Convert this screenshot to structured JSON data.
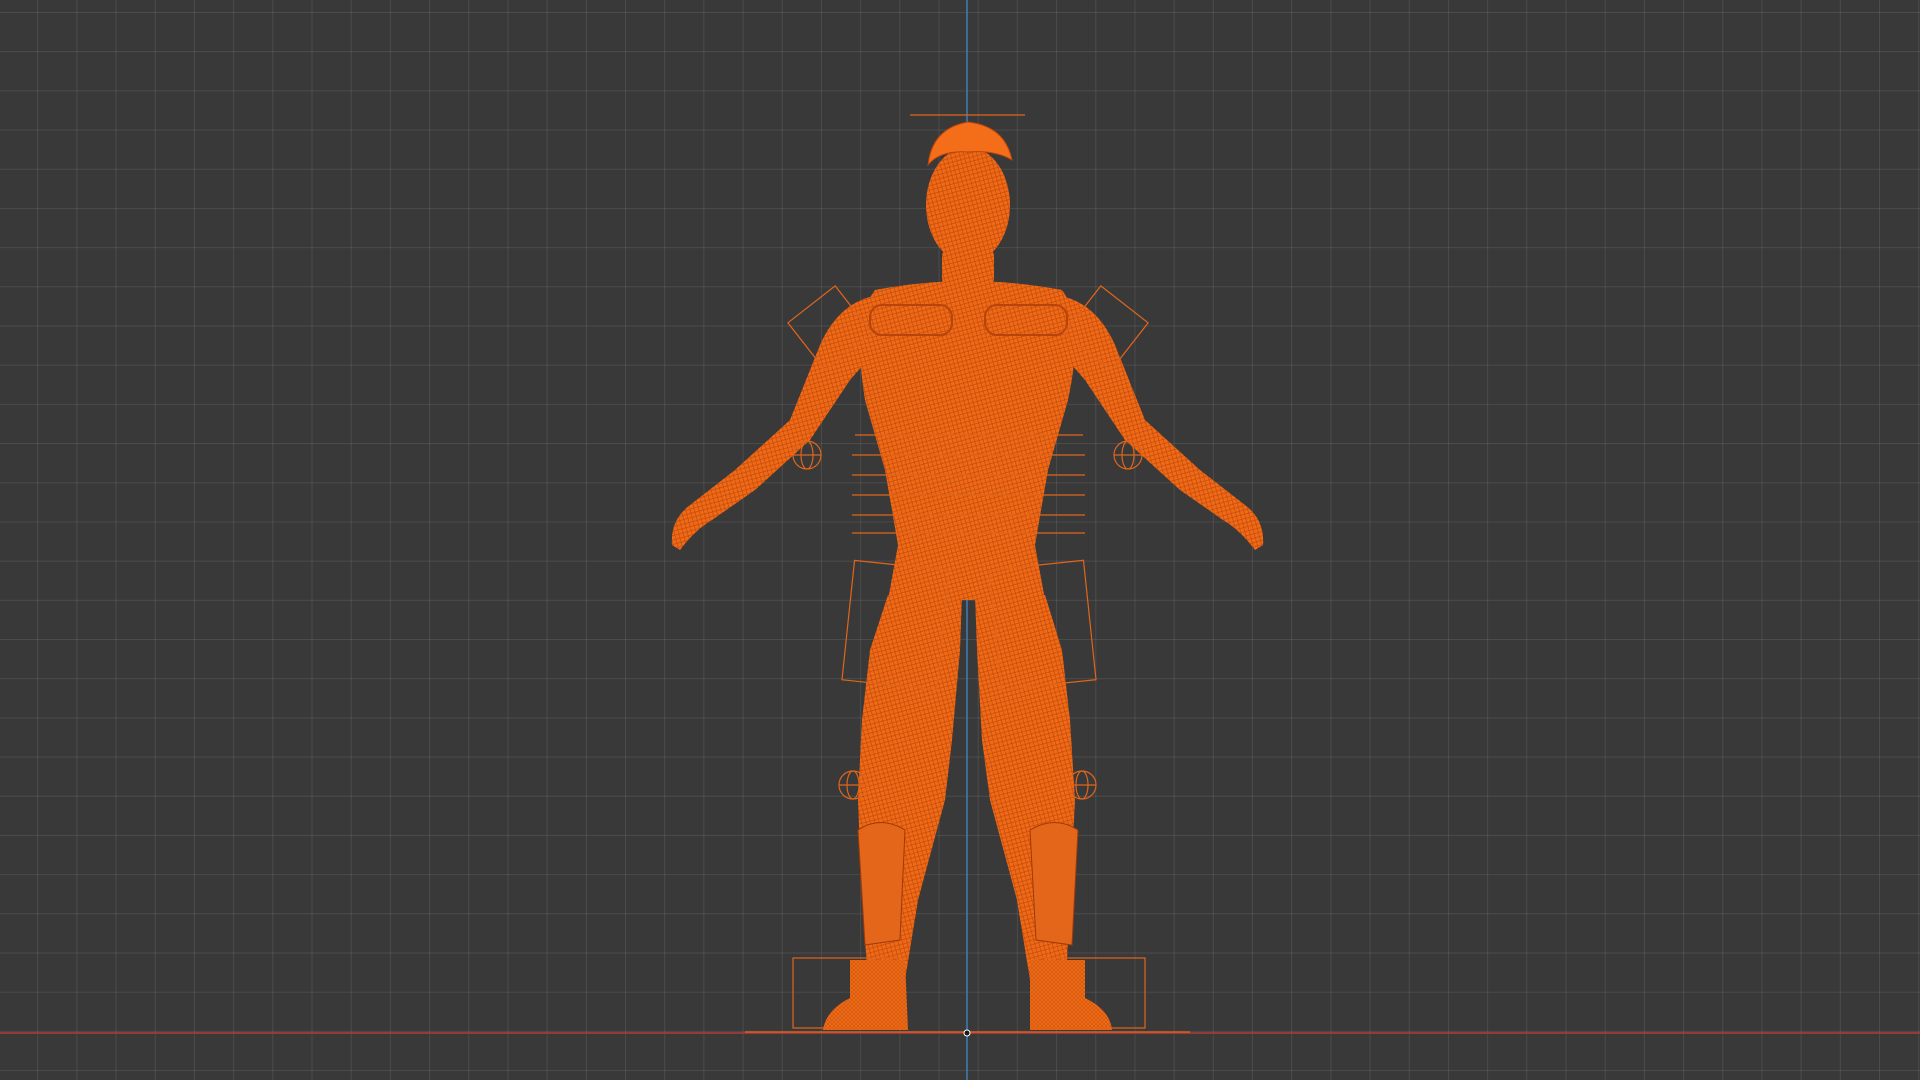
{
  "viewport": {
    "background_color": "#393939",
    "grid_color": "#4a4a4a",
    "x_axis_color": "#b33a3a",
    "z_axis_color": "#3f7fb5"
  },
  "object": {
    "mesh_name": "human-character-wireframe",
    "selection_color": "#ff6a14",
    "pose": "A-pose",
    "display_mode": "wireframe"
  },
  "helpers": {
    "empty_box_color": "#e0651b",
    "sphere_empty_color": "#e0651b"
  }
}
